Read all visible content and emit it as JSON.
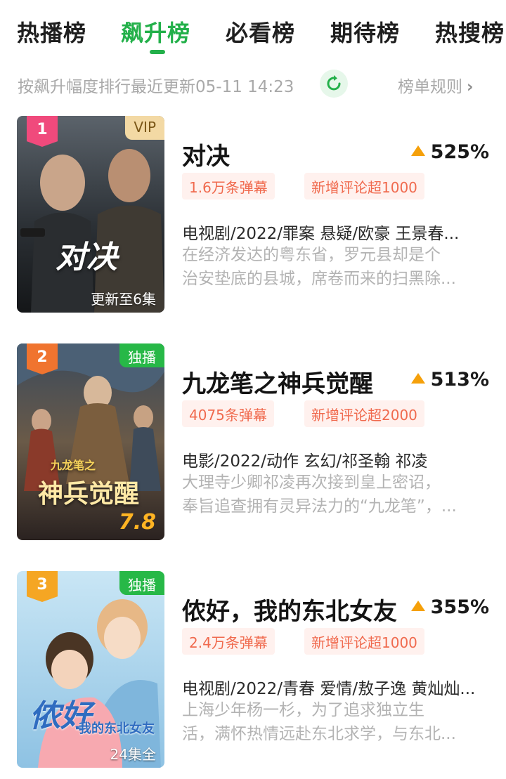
{
  "tabs": [
    {
      "label": "热播榜"
    },
    {
      "label": "飙升榜"
    },
    {
      "label": "必看榜"
    },
    {
      "label": "期待榜"
    },
    {
      "label": "热搜榜"
    }
  ],
  "active_tab": "飙升榜",
  "subbar": {
    "sort_text": "按飙升幅度排行最近更新05-11 14:23",
    "rules_label": "榜单规则",
    "rules_chevron": "›"
  },
  "colors": {
    "accent": "#23b04a",
    "rank_1": "#f04a7c",
    "rank_2": "#f0742f",
    "rank_3": "#f5a623",
    "pill_bg": "#fff1ee",
    "pill_text": "#f06a4e",
    "trend_arrow": "#f5a00a"
  },
  "items": [
    {
      "rank": "1",
      "corner_tag": "VIP",
      "bottom_tag": "更新至6集",
      "poster_title": "对决",
      "title": "对决",
      "trend": "525%",
      "danmaku": "1.6万条弹幕",
      "comments": "新增评论超1000",
      "meta": "电视剧/2022/罪案 悬疑/欧豪 王景春...",
      "desc_line1": "在经济发达的粤东省，罗元县却是个",
      "desc_line2": "治安垫底的县城，席卷而来的扫黑除..."
    },
    {
      "rank": "2",
      "corner_tag": "独播",
      "score": "7.8",
      "poster_title": "神兵觉醒",
      "poster_subtitle": "九龙笔之",
      "title": "九龙笔之神兵觉醒",
      "trend": "513%",
      "danmaku": "4075条弹幕",
      "comments": "新增评论超2000",
      "meta": "电影/2022/动作 玄幻/祁圣翰 祁凌",
      "desc_line1": "大理寺少卿祁凌再次接到皇上密诏，",
      "desc_line2": "奉旨追查拥有灵异法力的“九龙笔”，..."
    },
    {
      "rank": "3",
      "corner_tag": "独播",
      "bottom_tag": "24集全",
      "poster_title": "侬好",
      "poster_subtitle": "我的东北女友",
      "title": "侬好，我的东北女友",
      "trend": "355%",
      "danmaku": "2.4万条弹幕",
      "comments": "新增评论超1000",
      "meta": "电视剧/2022/青春 爱情/敖子逸 黄灿灿...",
      "desc_line1": "上海少年杨一杉，为了追求独立生",
      "desc_line2": "活，满怀热情远赴东北求学，与东北..."
    }
  ]
}
